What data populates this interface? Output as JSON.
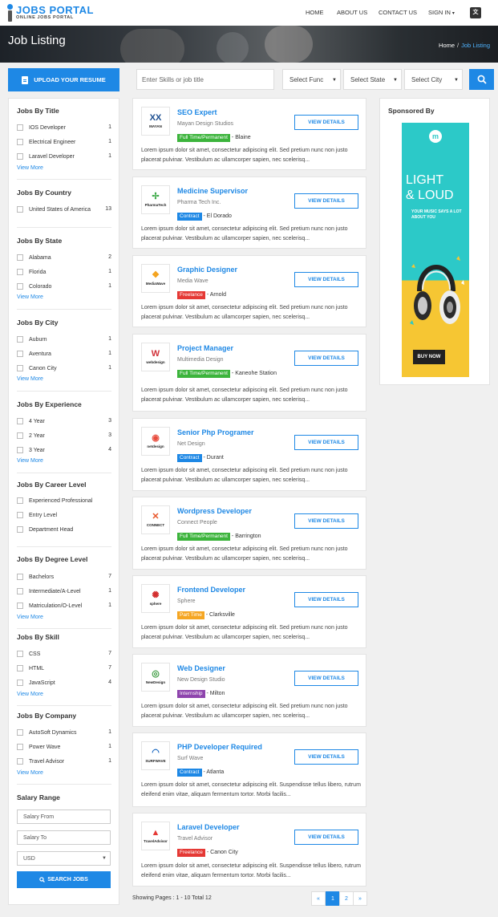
{
  "header": {
    "logo_title": "JOBS PORTAL",
    "logo_tagline": "ONLINE JOBS PORTAL",
    "nav": [
      "HOME",
      "ABOUT US",
      "CONTACT US",
      "SIGN IN"
    ],
    "lang_icon": "language-icon"
  },
  "hero": {
    "title": "Job Listing",
    "breadcrumb_home": "Home",
    "breadcrumb_sep": "/",
    "breadcrumb_current": "Job Listing"
  },
  "search": {
    "upload_label": "UPLOAD YOUR RESUME",
    "skills_placeholder": "Enter Skills or job title",
    "func_label": "Select Func",
    "state_label": "Select State",
    "city_label": "Select City"
  },
  "filters": {
    "title": {
      "heading": "Jobs By Title",
      "items": [
        {
          "label": "IOS Developer",
          "count": "1"
        },
        {
          "label": "Electrical Engineer",
          "count": "1"
        },
        {
          "label": "Laravel Developer",
          "count": "1"
        }
      ],
      "more": "View More"
    },
    "country": {
      "heading": "Jobs By Country",
      "items": [
        {
          "label": "United States of America",
          "count": "13"
        }
      ]
    },
    "state": {
      "heading": "Jobs By State",
      "items": [
        {
          "label": "Alabama",
          "count": "2"
        },
        {
          "label": "Florida",
          "count": "1"
        },
        {
          "label": "Colorado",
          "count": "1"
        }
      ],
      "more": "View More"
    },
    "city": {
      "heading": "Jobs By City",
      "items": [
        {
          "label": "Auburn",
          "count": "1"
        },
        {
          "label": "Aventura",
          "count": "1"
        },
        {
          "label": "Canon City",
          "count": "1"
        }
      ],
      "more": "View More"
    },
    "experience": {
      "heading": "Jobs By Experience",
      "items": [
        {
          "label": "4 Year",
          "count": "3"
        },
        {
          "label": "2 Year",
          "count": "3"
        },
        {
          "label": "3 Year",
          "count": "4"
        }
      ],
      "more": "View More"
    },
    "career": {
      "heading": "Jobs By Career Level",
      "items": [
        {
          "label": "Experienced Professional",
          "count": ""
        },
        {
          "label": "Entry Level",
          "count": ""
        },
        {
          "label": "Department Head",
          "count": ""
        }
      ]
    },
    "degree": {
      "heading": "Jobs By Degree Level",
      "items": [
        {
          "label": "Bachelors",
          "count": "7"
        },
        {
          "label": "Intermediate/A-Level",
          "count": "1"
        },
        {
          "label": "Matriculation/O-Level",
          "count": "1"
        }
      ],
      "more": "View More"
    },
    "skill": {
      "heading": "Jobs By Skill",
      "items": [
        {
          "label": "CSS",
          "count": "7"
        },
        {
          "label": "HTML",
          "count": "7"
        },
        {
          "label": "JavaScript",
          "count": "4"
        }
      ],
      "more": "View More"
    },
    "company": {
      "heading": "Jobs By Company",
      "items": [
        {
          "label": "AutoSoft Dynamics",
          "count": "1"
        },
        {
          "label": "Power Wave",
          "count": "1"
        },
        {
          "label": "Travel Advisor",
          "count": "1"
        }
      ],
      "more": "View More"
    }
  },
  "salary": {
    "heading": "Salary Range",
    "from_placeholder": "Salary From",
    "to_placeholder": "Salary To",
    "currency": "USD",
    "search_label": "SEARCH JOBS"
  },
  "jobs": [
    {
      "title": "SEO Expert",
      "company": "Mayan Design Studios",
      "type": "Full Time/Permanent",
      "type_color": "#3cb43c",
      "city": "- Blaine",
      "desc": "Lorem ipsum dolor sit amet, consectetur adipiscing elit. Sed pretium nunc non justo placerat pulvinar. Vestibulum ac ullamcorper sapien, nec scelerisq...",
      "logo_glyph": "XX",
      "logo_brand": "MAYAN",
      "logo_color": "#1a4d8f",
      "button": "VIEW DETAILS"
    },
    {
      "title": "Medicine Supervisor",
      "company": "Pharma Tech Inc.",
      "type": "Contract",
      "type_color": "#1e88e5",
      "city": "- El Dorado",
      "desc": "Lorem ipsum dolor sit amet, consectetur adipiscing elit. Sed pretium nunc non justo placerat pulvinar. Vestibulum ac ullamcorper sapien, nec scelerisq...",
      "logo_glyph": "✢",
      "logo_brand": "PharmaTech",
      "logo_color": "#3aa845",
      "button": "VIEW DETAILS"
    },
    {
      "title": "Graphic Designer",
      "company": "Media Wave",
      "type": "Freelance",
      "type_color": "#e53935",
      "city": "- Arnold",
      "desc": "Lorem ipsum dolor sit amet, consectetur adipiscing elit. Sed pretium nunc non justo placerat pulvinar. Vestibulum ac ullamcorper sapien, nec scelerisq...",
      "logo_glyph": "❖",
      "logo_brand": "MediaWave",
      "logo_color": "#f4a21b",
      "button": "VIEW DETAILS"
    },
    {
      "title": "Project Manager",
      "company": "Multimedia Design",
      "type": "Full Time/Permanent",
      "type_color": "#3cb43c",
      "city": "- Kaneohe Station",
      "desc": "Lorem ipsum dolor sit amet, consectetur adipiscing elit. Sed pretium nunc non justo placerat pulvinar. Vestibulum ac ullamcorper sapien, nec scelerisq...",
      "logo_glyph": "W",
      "logo_brand": "webdesign",
      "logo_color": "#d1323a",
      "button": "VIEW DETAILS"
    },
    {
      "title": "Senior Php Programer",
      "company": "Net Design",
      "type": "Contract",
      "type_color": "#1e88e5",
      "city": "- Durant",
      "desc": "Lorem ipsum dolor sit amet, consectetur adipiscing elit. Sed pretium nunc non justo placerat pulvinar. Vestibulum ac ullamcorper sapien, nec scelerisq...",
      "logo_glyph": "◉",
      "logo_brand": "netdesign",
      "logo_color": "#e84c3d",
      "button": "VIEW DETAILS"
    },
    {
      "title": "Wordpress Developer",
      "company": "Connect People",
      "type": "Full Time/Permanent",
      "type_color": "#3cb43c",
      "city": "- Barrington",
      "desc": "Lorem ipsum dolor sit amet, consectetur adipiscing elit. Sed pretium nunc non justo placerat pulvinar. Vestibulum ac ullamcorper sapien, nec scelerisq...",
      "logo_glyph": "✕",
      "logo_brand": "CONNECT",
      "logo_color": "#e8562a",
      "button": "VIEW DETAILS"
    },
    {
      "title": "Frontend Developer",
      "company": "Sphere",
      "type": "Part Time",
      "type_color": "#f5a623",
      "city": "- Clarksville",
      "desc": "Lorem ipsum dolor sit amet, consectetur adipiscing elit. Sed pretium nunc non justo placerat pulvinar. Vestibulum ac ullamcorper sapien, nec scelerisq...",
      "logo_glyph": "✺",
      "logo_brand": "sphere",
      "logo_color": "#d32f2f",
      "button": "VIEW DETAILS"
    },
    {
      "title": "Web Designer",
      "company": "New Design Studio",
      "type": "Internship",
      "type_color": "#8e44ad",
      "city": "- Milton",
      "desc": "Lorem ipsum dolor sit amet, consectetur adipiscing elit. Sed pretium nunc non justo placerat pulvinar. Vestibulum ac ullamcorper sapien, nec scelerisq...",
      "logo_glyph": "◎",
      "logo_brand": "NewDesign",
      "logo_color": "#3a9a3e",
      "button": "VIEW DETAILS"
    },
    {
      "title": "PHP Developer Required",
      "company": "Surf Wave",
      "type": "Contract",
      "type_color": "#1e88e5",
      "city": "- Atlanta",
      "desc": "Lorem ipsum dolor sit amet, consectetur adipiscing elit. Suspendisse tellus libero, rutrum eleifend enim vitae, aliquam fermentum tortor. Morbi facilis...",
      "logo_glyph": "◠",
      "logo_brand": "SURFWAVE",
      "logo_color": "#1565c0",
      "button": "VIEW DETAILS"
    },
    {
      "title": "Laravel Developer",
      "company": "Travel Advisor",
      "type": "Freelance",
      "type_color": "#e53935",
      "city": "- Canon City",
      "desc": "Lorem ipsum dolor sit amet, consectetur adipiscing elit. Suspendisse tellus libero, rutrum eleifend enim vitae, aliquam fermentum tortor. Morbi facilis...",
      "logo_glyph": "▲",
      "logo_brand": "TravelAdvisor",
      "logo_color": "#e53935",
      "button": "VIEW DETAILS"
    }
  ],
  "pagination": {
    "info": "Showing Pages : 1 - 10 Total 12",
    "prev": "«",
    "pages": [
      "1",
      "2"
    ],
    "next": "»"
  },
  "sponsor": {
    "heading": "Sponsored By",
    "logo_letter": "m",
    "headline_1": "LIGHT",
    "headline_2": "& LOUD",
    "sub": "YOUR MUSIC SAYS A LOT ABOUT YOU",
    "cta": "BUY NOW"
  },
  "colors": {
    "accent": "#1e88e5",
    "ad_teal": "#2cc9c8",
    "ad_yellow": "#f6c633"
  }
}
